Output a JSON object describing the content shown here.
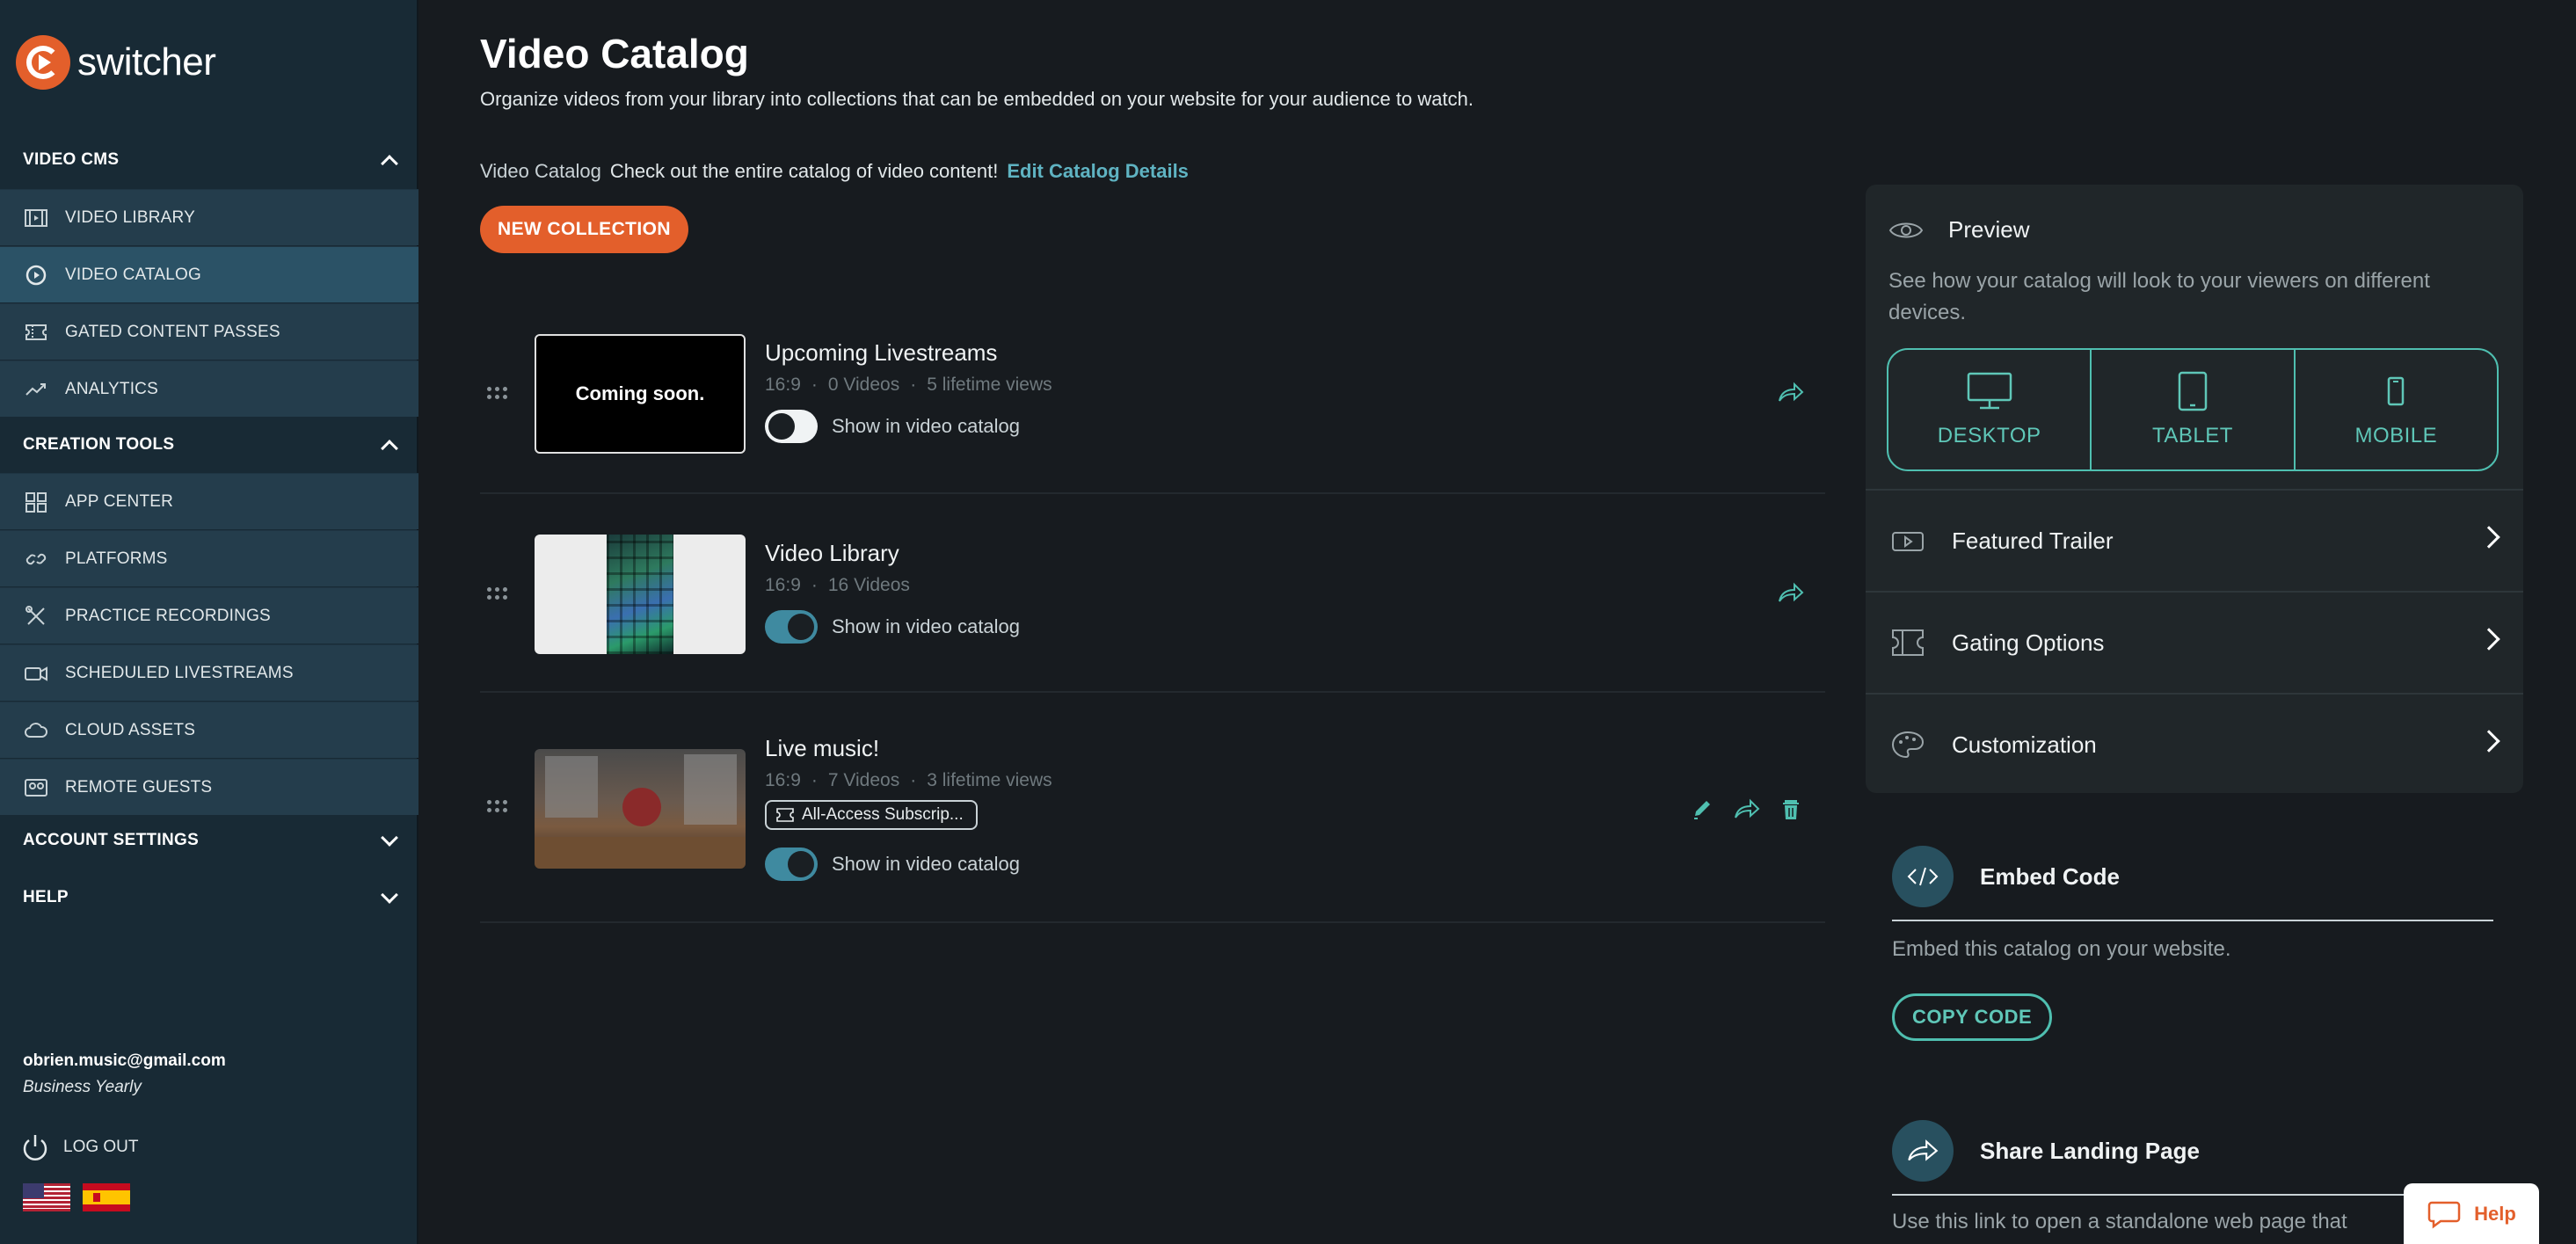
{
  "brand": {
    "name": "switcher",
    "accent": "#e35f2b",
    "teal": "#5fc7b8"
  },
  "sidebar": {
    "sections": [
      {
        "label": "VIDEO CMS",
        "expanded": true
      },
      {
        "label": "CREATION TOOLS",
        "expanded": true
      },
      {
        "label": "ACCOUNT SETTINGS",
        "expanded": false
      },
      {
        "label": "HELP",
        "expanded": false
      }
    ],
    "items": [
      {
        "label": "VIDEO LIBRARY",
        "icon": "film-icon"
      },
      {
        "label": "VIDEO CATALOG",
        "icon": "switcher-logo-icon",
        "active": true
      },
      {
        "label": "GATED CONTENT PASSES",
        "icon": "ticket-icon"
      },
      {
        "label": "ANALYTICS",
        "icon": "trend-icon"
      },
      {
        "label": "APP CENTER",
        "icon": "grid-icon"
      },
      {
        "label": "PLATFORMS",
        "icon": "link-icon"
      },
      {
        "label": "PRACTICE RECORDINGS",
        "icon": "tools-icon"
      },
      {
        "label": "SCHEDULED LIVESTREAMS",
        "icon": "camera-icon"
      },
      {
        "label": "CLOUD ASSETS",
        "icon": "cloud-icon"
      },
      {
        "label": "REMOTE GUESTS",
        "icon": "guests-icon"
      }
    ],
    "user": {
      "email": "obrien.music@gmail.com",
      "plan": "Business Yearly"
    },
    "logout_label": "LOG OUT",
    "flags": [
      "us-flag-icon",
      "spain-flag-icon"
    ]
  },
  "main": {
    "title": "Video Catalog",
    "subtitle": "Organize videos from your library into collections that can be embedded on your website for your audience to watch.",
    "catalog": {
      "name": "Video Catalog",
      "description": "Check out the entire catalog of video content!",
      "edit_link": "Edit Catalog Details"
    },
    "new_collection_label": "NEW COLLECTION",
    "collections": [
      {
        "title": "Upcoming Livestreams",
        "ratio": "16:9",
        "videos": "0 Videos",
        "views": "5 lifetime views",
        "thumb_text": "Coming soon.",
        "toggle_label": "Show in video catalog",
        "shown": false
      },
      {
        "title": "Video Library",
        "ratio": "16:9",
        "videos": "16 Videos",
        "toggle_label": "Show in video catalog",
        "shown": true
      },
      {
        "title": "Live music!",
        "ratio": "16:9",
        "videos": "7 Videos",
        "views": "3 lifetime views",
        "badge": "All-Access Subscrip...",
        "toggle_label": "Show in video catalog",
        "shown": true
      }
    ]
  },
  "preview": {
    "title": "Preview",
    "description": "See how your catalog will look to your viewers on different devices.",
    "devices": [
      "DESKTOP",
      "TABLET",
      "MOBILE"
    ],
    "options": [
      "Featured Trailer",
      "Gating Options",
      "Customization"
    ]
  },
  "embed": {
    "title": "Embed Code",
    "description": "Embed this catalog on your website.",
    "button": "COPY CODE"
  },
  "share": {
    "title": "Share Landing Page",
    "description": "Use this link to open a standalone web page that"
  },
  "help_label": "Help"
}
